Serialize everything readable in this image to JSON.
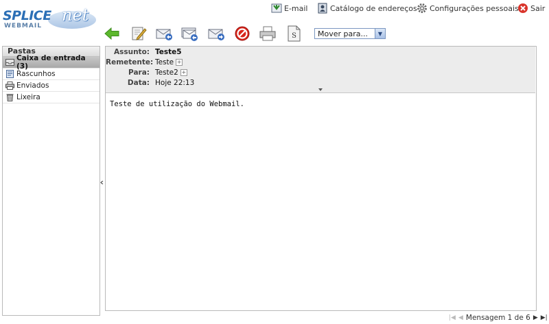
{
  "brand": {
    "logo_main": "SPLICE",
    "logo_net": "net",
    "logo_sub": "WEBMAIL"
  },
  "toplinks": [
    {
      "label": "E-mail",
      "icon": "email-icon"
    },
    {
      "label": "Catálogo de endereços",
      "icon": "address-book-icon"
    },
    {
      "label": "Configurações pessoais",
      "icon": "settings-gear-icon"
    },
    {
      "label": "Sair",
      "icon": "logout-icon"
    }
  ],
  "toolbar": {
    "buttons": [
      "back-icon",
      "compose-icon",
      "reply-icon",
      "reply-all-icon",
      "forward-icon",
      "delete-icon",
      "print-icon",
      "source-icon"
    ],
    "move_placeholder": "Mover para..."
  },
  "folders": {
    "title": "Pastas",
    "items": [
      {
        "label": "Caixa de entrada (3)",
        "icon": "inbox-icon",
        "active": true
      },
      {
        "label": "Rascunhos",
        "icon": "drafts-icon"
      },
      {
        "label": "Enviados",
        "icon": "sent-icon"
      },
      {
        "label": "Lixeira",
        "icon": "trash-icon"
      }
    ]
  },
  "message": {
    "subject_label": "Assunto:",
    "subject": "Teste5",
    "from_label": "Remetente:",
    "from": "Teste",
    "to_label": "Para:",
    "to": "Teste2",
    "date_label": "Data:",
    "date": "Hoje 22:13",
    "body": "Teste de utilização do Webmail."
  },
  "pager": {
    "text": "Mensagem 1 de 6"
  },
  "colors": {
    "brand_blue": "#2b6fb6",
    "active_folder": "#b0b0b0",
    "header_bg": "#ececec"
  }
}
